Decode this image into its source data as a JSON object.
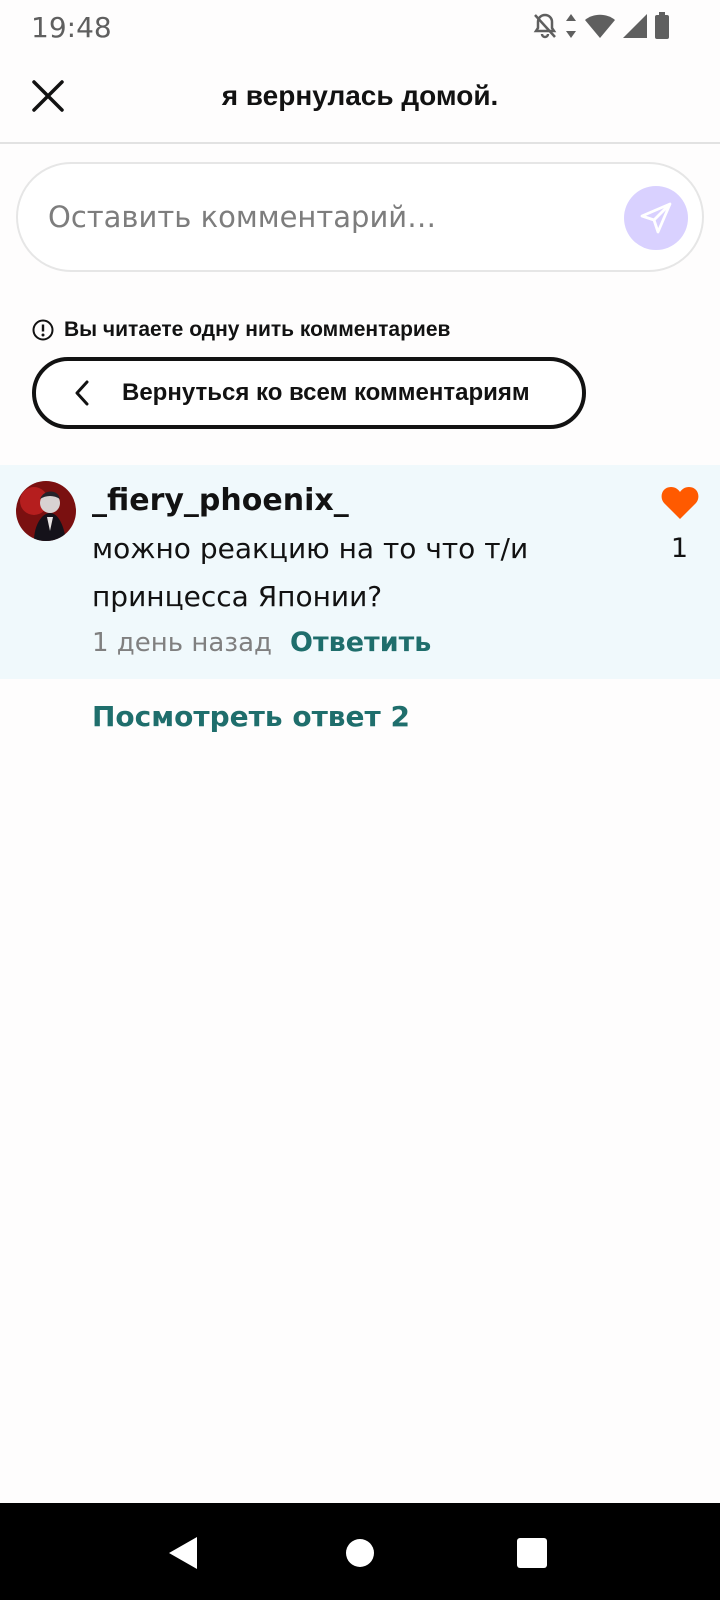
{
  "status_bar": {
    "time": "19:48",
    "icons": [
      "bell-off-icon",
      "data-arrows-icon",
      "wifi-icon",
      "cell-signal-icon",
      "battery-icon"
    ]
  },
  "header": {
    "title": "я вернулась домой.",
    "close_icon": "close-icon"
  },
  "comment_input": {
    "placeholder": "Оставить комментарий…",
    "send_icon": "send-icon",
    "send_color": "#d9d1ff"
  },
  "thread": {
    "notice": "Вы читаете одну нить комментариев",
    "back_label": "Вернуться ко всем комментариям"
  },
  "comment": {
    "username": "_fiery_phoenix_",
    "text": "можно реакцию на то что т/и принцесса Японии?",
    "time": "1 день назад",
    "reply_label": "Ответить",
    "likes": "1",
    "like_color": "#ff5a00",
    "background": "#f0f9fc"
  },
  "view_replies": "Посмотреть ответ 2",
  "colors": {
    "accent": "#1f6e6c"
  }
}
